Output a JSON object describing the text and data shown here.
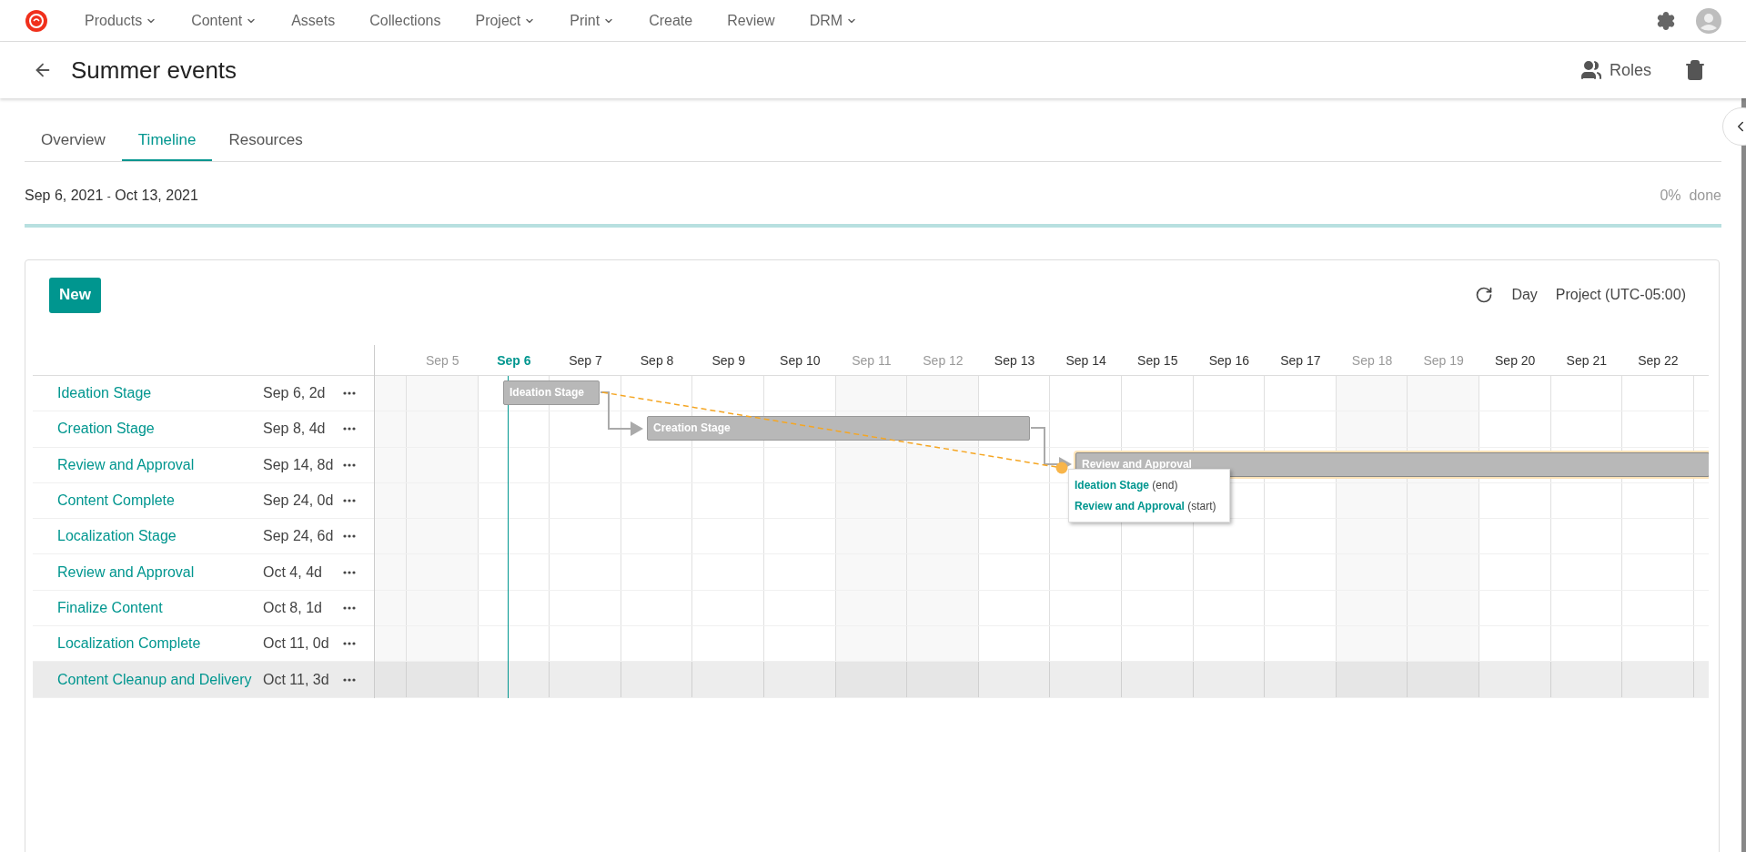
{
  "nav": {
    "items": [
      {
        "label": "Products",
        "has_menu": true
      },
      {
        "label": "Content",
        "has_menu": true
      },
      {
        "label": "Assets",
        "has_menu": false
      },
      {
        "label": "Collections",
        "has_menu": false
      },
      {
        "label": "Project",
        "has_menu": true
      },
      {
        "label": "Print",
        "has_menu": true
      },
      {
        "label": "Create",
        "has_menu": false
      },
      {
        "label": "Review",
        "has_menu": false
      },
      {
        "label": "DRM",
        "has_menu": true
      }
    ]
  },
  "header": {
    "title": "Summer events",
    "roles_label": "Roles"
  },
  "tabs": [
    {
      "label": "Overview",
      "selected": false
    },
    {
      "label": "Timeline",
      "selected": true
    },
    {
      "label": "Resources",
      "selected": false
    }
  ],
  "date_range": {
    "start": "Sep 6, 2021",
    "separator": "-",
    "end": "Oct 13, 2021"
  },
  "progress": {
    "percent": "0%",
    "suffix": "done",
    "level": 0
  },
  "toolbar": {
    "new_label": "New",
    "scale": "Day",
    "timezone": "Project (UTC-05:00)"
  },
  "days": [
    {
      "label": "Sep 5",
      "weekend": true,
      "today": false
    },
    {
      "label": "Sep 6",
      "weekend": false,
      "today": true
    },
    {
      "label": "Sep 7",
      "weekend": false,
      "today": false
    },
    {
      "label": "Sep 8",
      "weekend": false,
      "today": false
    },
    {
      "label": "Sep 9",
      "weekend": false,
      "today": false
    },
    {
      "label": "Sep 10",
      "weekend": false,
      "today": false
    },
    {
      "label": "Sep 11",
      "weekend": true,
      "today": false
    },
    {
      "label": "Sep 12",
      "weekend": true,
      "today": false
    },
    {
      "label": "Sep 13",
      "weekend": false,
      "today": false
    },
    {
      "label": "Sep 14",
      "weekend": false,
      "today": false
    },
    {
      "label": "Sep 15",
      "weekend": false,
      "today": false
    },
    {
      "label": "Sep 16",
      "weekend": false,
      "today": false
    },
    {
      "label": "Sep 17",
      "weekend": false,
      "today": false
    },
    {
      "label": "Sep 18",
      "weekend": true,
      "today": false
    },
    {
      "label": "Sep 19",
      "weekend": true,
      "today": false
    },
    {
      "label": "Sep 20",
      "weekend": false,
      "today": false
    },
    {
      "label": "Sep 21",
      "weekend": false,
      "today": false
    },
    {
      "label": "Sep 22",
      "weekend": false,
      "today": false
    }
  ],
  "tasks": [
    {
      "name": "Ideation Stage",
      "schedule": "Sep 6, 2d",
      "selected": false
    },
    {
      "name": "Creation Stage",
      "schedule": "Sep 8, 4d",
      "selected": false
    },
    {
      "name": "Review and Approval",
      "schedule": "Sep 14, 8d",
      "selected": false
    },
    {
      "name": "Content Complete",
      "schedule": "Sep 24, 0d",
      "selected": false
    },
    {
      "name": "Localization Stage",
      "schedule": "Sep 24, 6d",
      "selected": false
    },
    {
      "name": "Review and Approval",
      "schedule": "Oct 4, 4d",
      "selected": false
    },
    {
      "name": "Finalize Content",
      "schedule": "Oct 8, 1d",
      "selected": false
    },
    {
      "name": "Localization Complete",
      "schedule": "Oct 11, 0d",
      "selected": false
    },
    {
      "name": "Content Cleanup and Delivery",
      "schedule": "Oct 11, 3d",
      "selected": true
    }
  ],
  "bars": [
    {
      "label": "Ideation Stage",
      "highlighted": false
    },
    {
      "label": "Creation Stage",
      "highlighted": false
    },
    {
      "label": "Review and Approval",
      "highlighted": true
    }
  ],
  "tooltip": {
    "lines": [
      {
        "name": "Ideation Stage",
        "role": "(end)"
      },
      {
        "name": "Review and Approval",
        "role": "(start)"
      }
    ]
  }
}
